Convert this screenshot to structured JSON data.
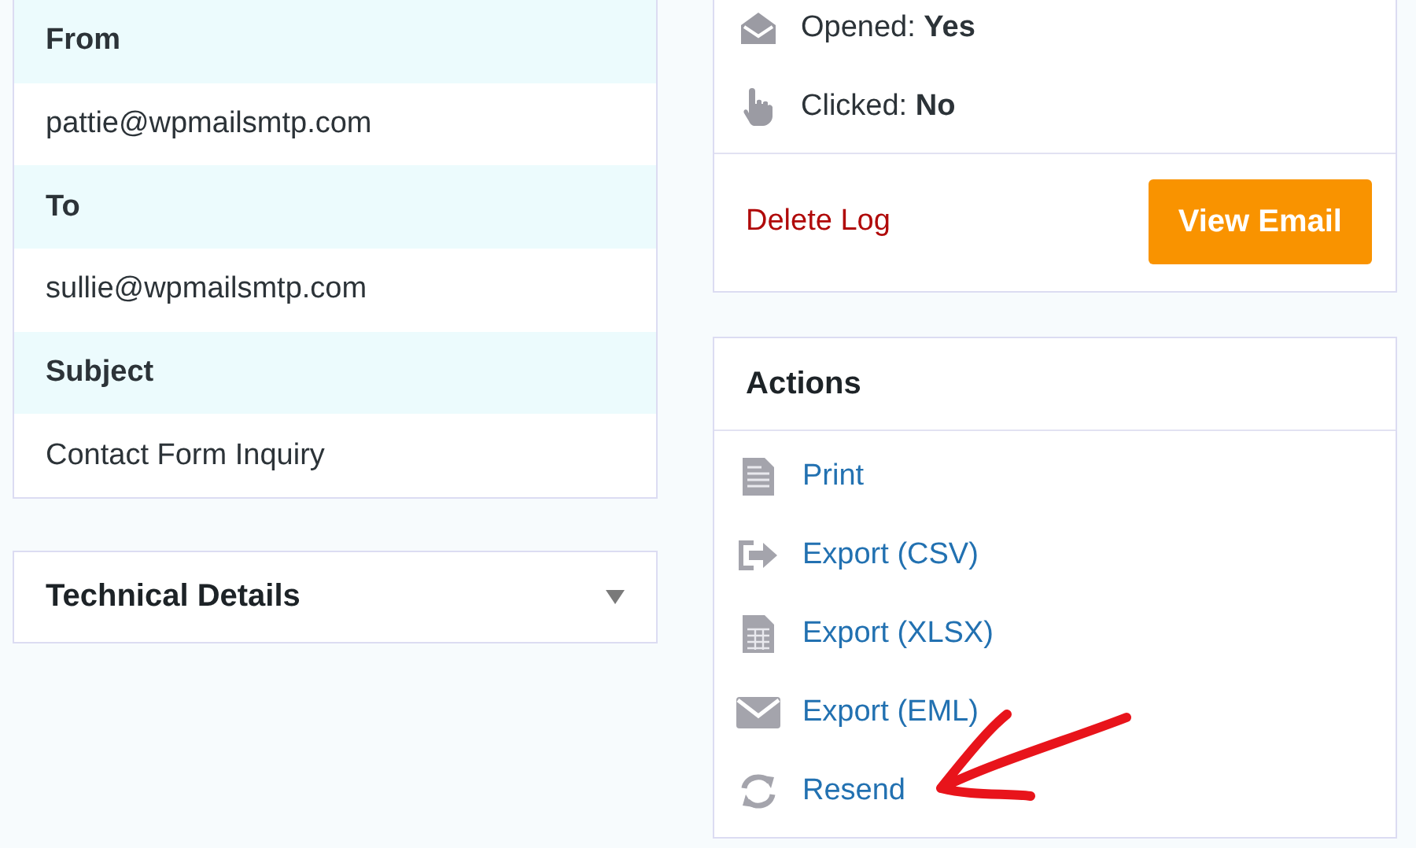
{
  "email_details": {
    "fields": [
      {
        "label": "From",
        "value": "pattie@wpmailsmtp.com"
      },
      {
        "label": "To",
        "value": "sullie@wpmailsmtp.com"
      },
      {
        "label": "Subject",
        "value": "Contact Form Inquiry"
      }
    ]
  },
  "technical_details": {
    "title": "Technical Details",
    "expanded": false
  },
  "status": {
    "items": [
      {
        "kind": "opened",
        "text": "Opened: **Yes**"
      },
      {
        "kind": "clicked",
        "text": "Clicked: **No**"
      }
    ],
    "delete_link": "Delete Log",
    "view_button": "View Email"
  },
  "actions": {
    "title": "Actions",
    "items": [
      {
        "kind": "print",
        "label": "Print"
      },
      {
        "kind": "export",
        "label": "Export (CSV)"
      },
      {
        "kind": "spreadsheet",
        "label": "Export (XLSX)"
      },
      {
        "kind": "email",
        "label": "Export (EML)"
      },
      {
        "kind": "resend",
        "label": "Resend"
      }
    ]
  }
}
